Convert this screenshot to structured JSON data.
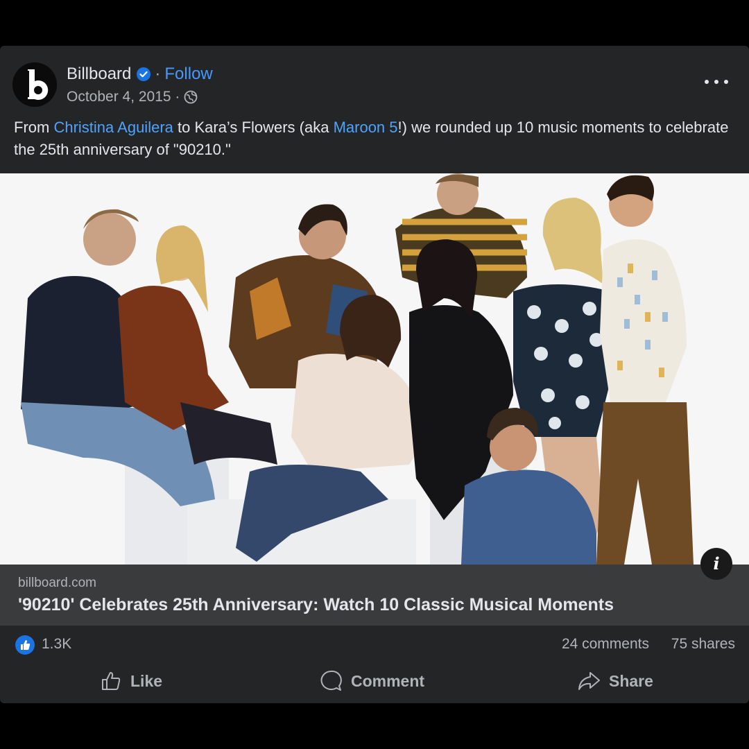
{
  "post": {
    "author": "Billboard",
    "follow_label": "Follow",
    "separator": "·",
    "date": "October 4, 2015 ·",
    "avatar_logo_text": "billboard",
    "caption_parts": {
      "p1": "From ",
      "link1": "Christina Aguilera",
      "p2": " to Kara’s Flowers (aka ",
      "link2": "Maroon 5",
      "p3": "!) we rounded up 10 music moments to celebrate the 25th anniversary of \"90210.\""
    }
  },
  "link_preview": {
    "domain": "billboard.com",
    "title": "'90210' Celebrates 25th Anniversary: Watch 10 Classic Musical Moments",
    "info_icon": "i"
  },
  "stats": {
    "reactions": "1.3K",
    "comments": "24 comments",
    "shares": "75 shares"
  },
  "actions": {
    "like": "Like",
    "comment": "Comment",
    "share": "Share"
  },
  "colors": {
    "card_bg": "#242526",
    "link_blue": "#4ea3ff",
    "like_blue": "#1b74e4",
    "link_box_bg": "#3a3b3c"
  }
}
